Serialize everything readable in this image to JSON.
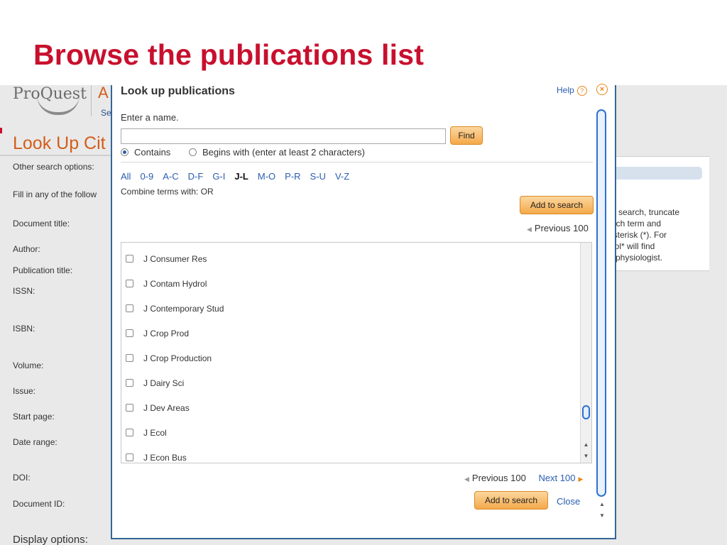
{
  "slide_title": "Browse the publications list",
  "background": {
    "logo_text": "ProQuest",
    "product_initial": "A",
    "product_sub": "Se",
    "heading": "Look Up Cit",
    "labels": [
      "Other search options:",
      "Fill in any of the follow",
      "Document title:",
      "Author:",
      "Publication title:",
      "ISSN:",
      "ISBN:",
      "Volume:",
      "Issue:",
      "Start page:",
      "Date range:",
      "DOI:",
      "Document ID:"
    ],
    "display_options": "Display options:",
    "tip_lines": [
      "ur search, truncate",
      "arch term and",
      "asterisk (*).  For",
      "siol* will find",
      "d physiologist."
    ]
  },
  "dialog": {
    "title": "Look up publications",
    "help": "Help",
    "help_symbol": "?",
    "close_symbol": "×",
    "enter_label": "Enter a name.",
    "name_value": "",
    "find_label": "Find",
    "radio_contains": "Contains",
    "radio_begins": "Begins with (enter at least 2 characters)",
    "alpha": [
      "All",
      "0-9",
      "A-C",
      "D-F",
      "G-I",
      "J-L",
      "M-O",
      "P-R",
      "S-U",
      "V-Z"
    ],
    "combine": "Combine terms with: OR",
    "add_to_search": "Add to search",
    "previous_100": "Previous 100",
    "next_100": "Next 100",
    "close_label": "Close",
    "publications": [
      "J Consumer Res",
      "J Contam Hydrol",
      "J Contemporary Stud",
      "J Crop Prod",
      "J Crop Production",
      "J Dairy Sci",
      "J Dev Areas",
      "J Ecol",
      "J Econ Bus"
    ]
  },
  "colors": {
    "title_red": "#c8102e",
    "link_blue": "#2a5db0",
    "button_orange": "#f4a94a",
    "dialog_border": "#336699",
    "brand_orange": "#d25e1c"
  }
}
